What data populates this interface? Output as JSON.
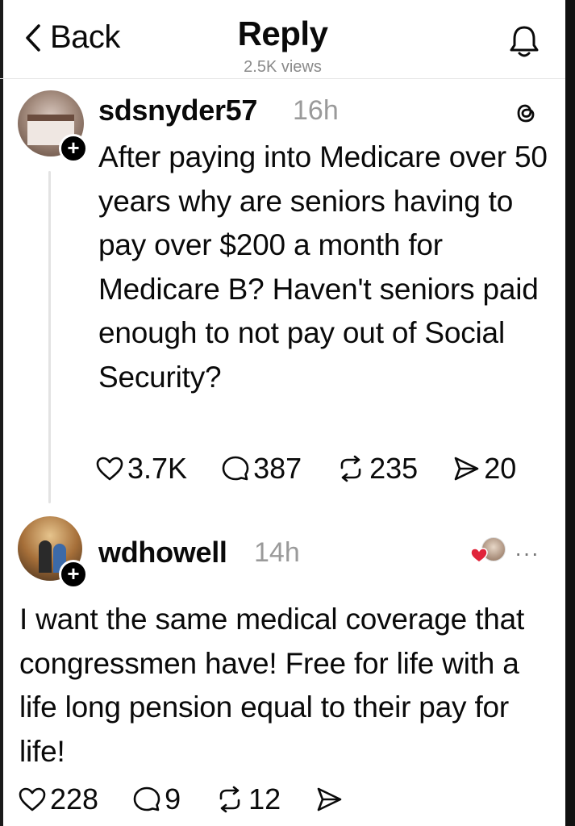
{
  "header": {
    "back_label": "Back",
    "title": "Reply",
    "views": "2.5K views"
  },
  "post": {
    "username": "sdsnyder57",
    "time": "16h",
    "text": "After paying into Medicare over 50 years why are seniors having to pay over $200 a month for Medicare B? Haven't seniors paid enough to not pay out of Social Security?",
    "likes": "3.7K",
    "replies": "387",
    "reposts": "235",
    "shares": "20"
  },
  "reply": {
    "username": "wdhowell",
    "time": "14h",
    "more": "···",
    "text": "I want the same medical coverage that congressmen have! Free for life with a life long pension equal to their pay for life!",
    "likes": "228",
    "replies": "9",
    "reposts": "12"
  },
  "colors": {
    "text": "#0a0a0a",
    "muted": "#9a9a9a",
    "like_heart": "#e0243a"
  }
}
